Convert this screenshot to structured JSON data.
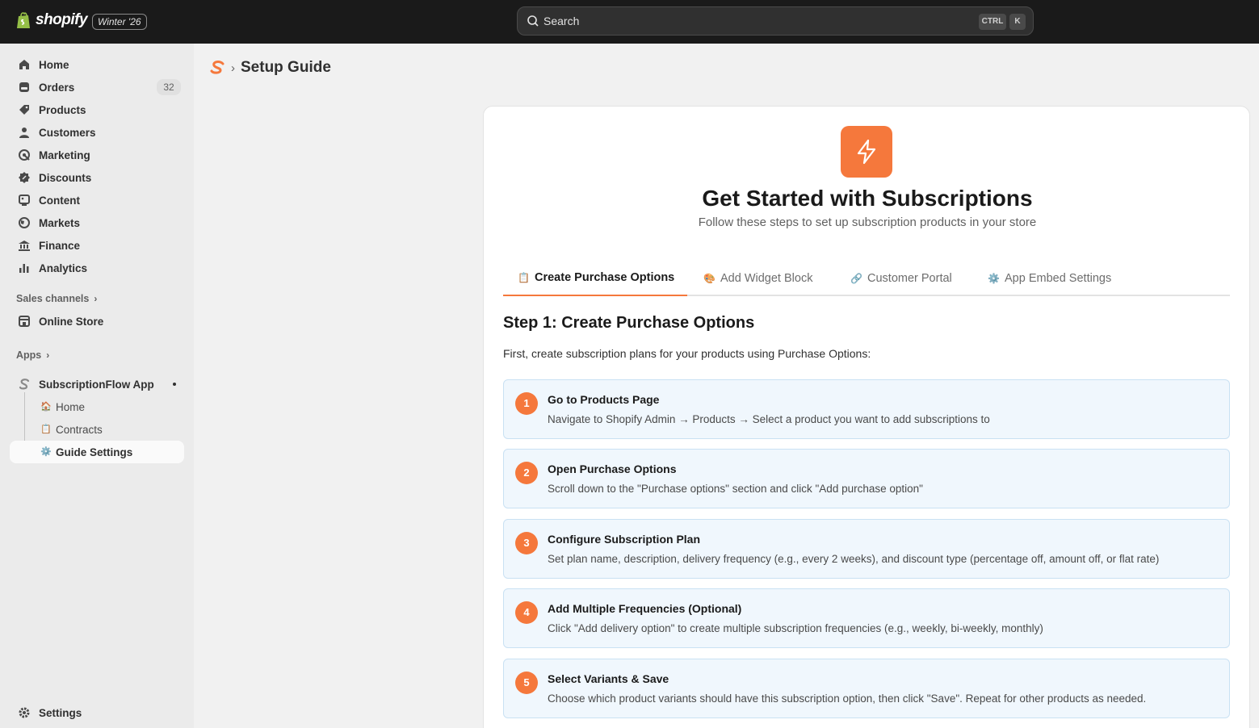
{
  "topbar": {
    "brand": "shopify",
    "edition": "Winter '26",
    "search": {
      "placeholder": "Search",
      "shortcut_ctrl": "CTRL",
      "shortcut_key": "K"
    }
  },
  "sidebar": {
    "items": [
      {
        "label": "Home",
        "icon": "home-icon"
      },
      {
        "label": "Orders",
        "icon": "orders-icon",
        "badge": "32"
      },
      {
        "label": "Products",
        "icon": "tag-icon"
      },
      {
        "label": "Customers",
        "icon": "person-icon"
      },
      {
        "label": "Marketing",
        "icon": "target-icon"
      },
      {
        "label": "Discounts",
        "icon": "discount-icon"
      },
      {
        "label": "Content",
        "icon": "content-icon"
      },
      {
        "label": "Markets",
        "icon": "globe-icon"
      },
      {
        "label": "Finance",
        "icon": "bank-icon"
      },
      {
        "label": "Analytics",
        "icon": "bar-chart-icon"
      }
    ],
    "sales_channels_label": "Sales channels",
    "online_store_label": "Online Store",
    "apps_label": "Apps",
    "app": {
      "label": "SubscriptionFlow App",
      "sub_items": [
        {
          "label": "Home",
          "emoji": "🏠"
        },
        {
          "label": "Contracts",
          "emoji": "📋"
        },
        {
          "label": "Guide Settings",
          "emoji": "⚙️"
        }
      ]
    },
    "settings_label": "Settings"
  },
  "page": {
    "title": "Setup Guide",
    "separator": "›"
  },
  "hero": {
    "title": "Get Started with Subscriptions",
    "subtitle": "Follow these steps to set up subscription products in your store"
  },
  "tabs": [
    {
      "label": "Create Purchase Options",
      "emoji": "📋"
    },
    {
      "label": "Add Widget Block",
      "emoji": "🎨"
    },
    {
      "label": "Customer Portal",
      "emoji": "🔗"
    },
    {
      "label": "App Embed Settings",
      "emoji": "⚙️"
    }
  ],
  "step_section": {
    "title": "Step 1: Create Purchase Options",
    "intro": "First, create subscription plans for your products using Purchase Options:",
    "steps": [
      {
        "num": "1",
        "title": "Go to Products Page",
        "desc": "Navigate to Shopify Admin → Products → Select a product you want to add subscriptions to"
      },
      {
        "num": "2",
        "title": "Open Purchase Options",
        "desc": "Scroll down to the \"Purchase options\" section and click \"Add purchase option\""
      },
      {
        "num": "3",
        "title": "Configure Subscription Plan",
        "desc": "Set plan name, description, delivery frequency (e.g., every 2 weeks), and discount type (percentage off, amount off, or flat rate)"
      },
      {
        "num": "4",
        "title": "Add Multiple Frequencies (Optional)",
        "desc": "Click \"Add delivery option\" to create multiple subscription frequencies (e.g., weekly, bi-weekly, monthly)"
      },
      {
        "num": "5",
        "title": "Select Variants & Save",
        "desc": "Choose which product variants should have this subscription option, then click \"Save\". Repeat for other products as needed."
      }
    ]
  },
  "colors": {
    "accent": "#f5783c",
    "topbar": "#1a1a1a",
    "step_bg": "#f0f7fd"
  }
}
